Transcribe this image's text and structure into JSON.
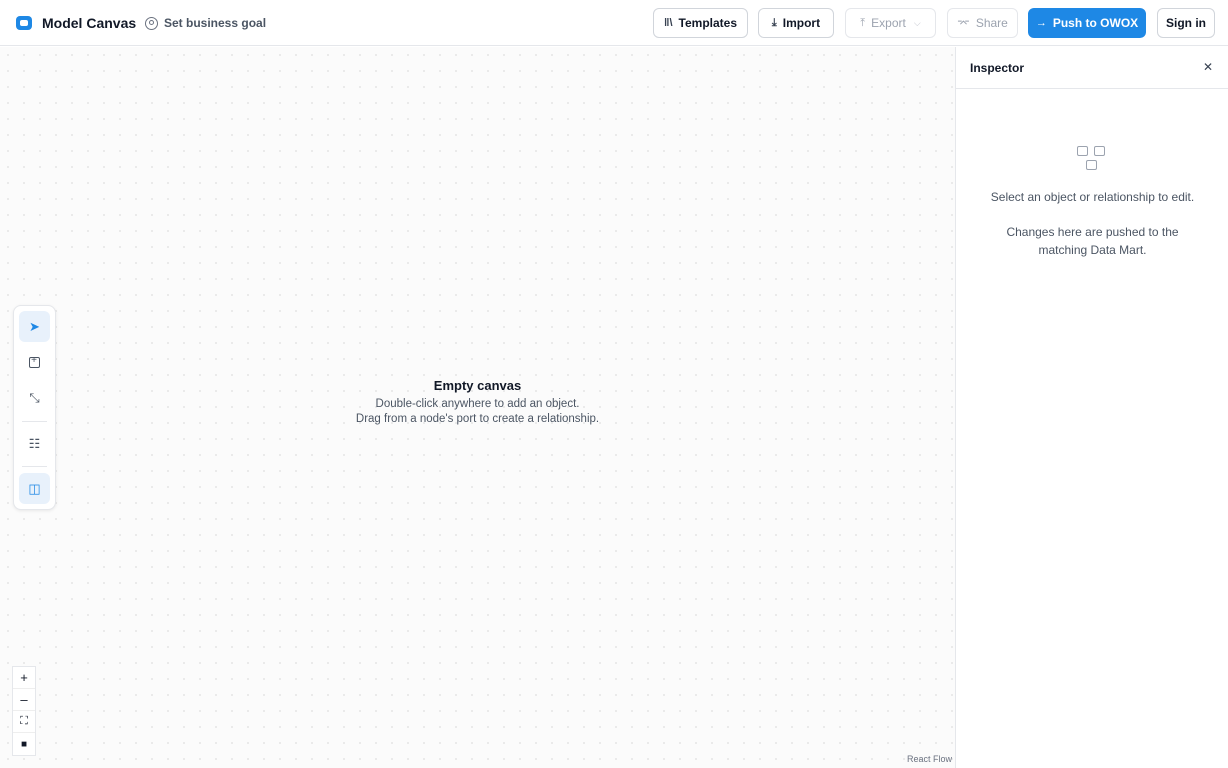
{
  "header": {
    "app_title": "Model Canvas",
    "goal_label": "Set business goal",
    "buttons": {
      "templates": "Templates",
      "import": "Import",
      "export": "Export",
      "share": "Share",
      "push": "Push to OWOX",
      "signin": "Sign in"
    }
  },
  "canvas": {
    "empty_title": "Empty canvas",
    "empty_line1": "Double-click anywhere to add an object.",
    "empty_line2": "Drag from a node's port to create a relationship.",
    "attribution": "React Flow"
  },
  "inspector": {
    "title": "Inspector",
    "hint": "Select an object or relationship to edit.",
    "note": "Changes here are pushed to the matching Data Mart."
  },
  "colors": {
    "accent": "#1e88e5"
  }
}
